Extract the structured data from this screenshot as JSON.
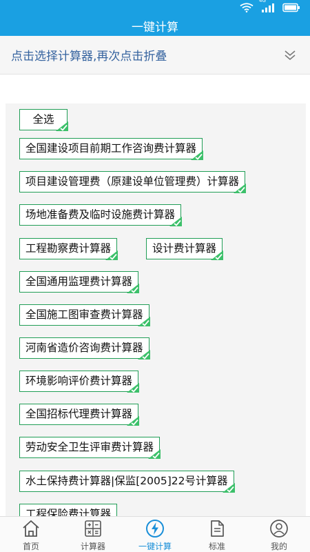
{
  "status_bar": {
    "network": "4G"
  },
  "title": "一键计算",
  "collapse_header": "点击选择计算器,再次点击折叠",
  "chips": [
    {
      "label": "全选",
      "checked": true
    },
    {
      "label": "全国建设项目前期工作咨询费计算器",
      "checked": true
    },
    {
      "label": "项目建设管理费（原建设单位管理费）计算器",
      "checked": true
    },
    {
      "label": "场地准备费及临时设施费计算器",
      "checked": true
    },
    {
      "label": "工程勘察费计算器",
      "checked": true
    },
    {
      "label": "设计费计算器",
      "checked": true
    },
    {
      "label": "全国通用监理费计算器",
      "checked": true
    },
    {
      "label": "全国施工图审查费计算器",
      "checked": true
    },
    {
      "label": "河南省造价咨询费计算器",
      "checked": true
    },
    {
      "label": "环境影响评价费计算器",
      "checked": true
    },
    {
      "label": "全国招标代理费计算器",
      "checked": true
    },
    {
      "label": "劳动安全卫生评审费计算器",
      "checked": true
    },
    {
      "label": "水土保持费计算器|保监[2005]22号计算器",
      "checked": true
    },
    {
      "label": "工程保险费计算器",
      "checked": true
    }
  ],
  "tabs": [
    {
      "label": "首页",
      "icon": "home-icon",
      "active": false
    },
    {
      "label": "计算器",
      "icon": "calculator-icon",
      "active": false
    },
    {
      "label": "一键计算",
      "icon": "lightning-icon",
      "active": true
    },
    {
      "label": "标准",
      "icon": "document-icon",
      "active": false
    },
    {
      "label": "我的",
      "icon": "user-icon",
      "active": false
    }
  ],
  "colors": {
    "primary": "#1aa0e2",
    "chip_border": "#1f9d55",
    "tab_active": "#1a8fd8"
  }
}
